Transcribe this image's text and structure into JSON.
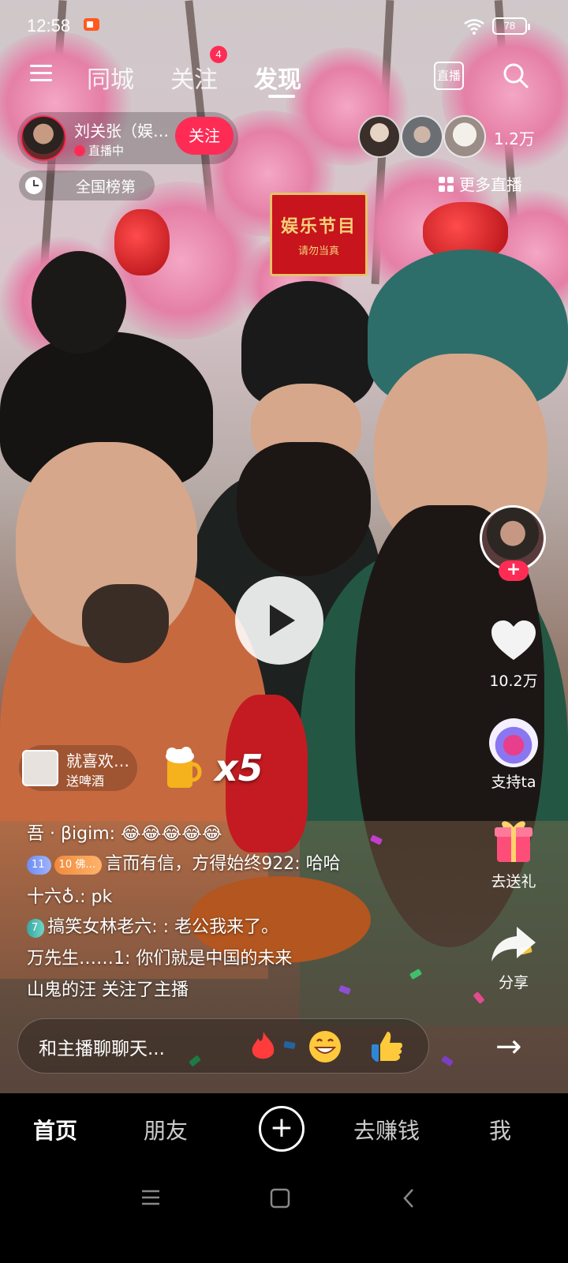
{
  "status_bar": {
    "time": "12:58",
    "battery": "78"
  },
  "top_nav": {
    "menu_icon": "menu-icon",
    "tabs": [
      {
        "label": "同城"
      },
      {
        "label": "关注",
        "badge": "4"
      },
      {
        "label": "发现",
        "active": true
      }
    ],
    "live_label": "直播",
    "search_icon": "search-icon"
  },
  "streamer": {
    "name": "刘关张（娱…",
    "status": "直播中",
    "follow_label": "关注",
    "viewer_count": "1.2万",
    "rank_label": "全国榜第",
    "more_live_label": "更多直播"
  },
  "right_rail": {
    "likes": "10.2万",
    "support_label": "支持ta",
    "gift_label": "去送礼",
    "share_label": "分享"
  },
  "gift": {
    "user": "就喜欢…",
    "gift_name": "送啤酒",
    "multiplier": "x5"
  },
  "chat": [
    {
      "text": "吾 · βigim: 😂😂😂😂😂"
    },
    {
      "badges": [
        "11",
        "10 佛…"
      ],
      "text": "言而有信，方得始终922: 哈哈"
    },
    {
      "text": "十六♁.: pk"
    },
    {
      "badges": [
        "7"
      ],
      "text": "搞笑女林老六: : 老公我来了。"
    },
    {
      "text": "万先生……1: 你们就是中国的未来"
    },
    {
      "text": "山鬼的汪 关注了主播"
    }
  ],
  "comment_bar": {
    "placeholder": "和主播聊聊天..."
  },
  "bottom_nav": {
    "items": [
      "首页",
      "朋友",
      "去赚钱",
      "我"
    ],
    "create_label": "+"
  },
  "video_sign": {
    "line1": "娱乐节目",
    "line2": "请勿当真"
  },
  "colors": {
    "accent": "#fe2c55",
    "background": "#000000"
  }
}
